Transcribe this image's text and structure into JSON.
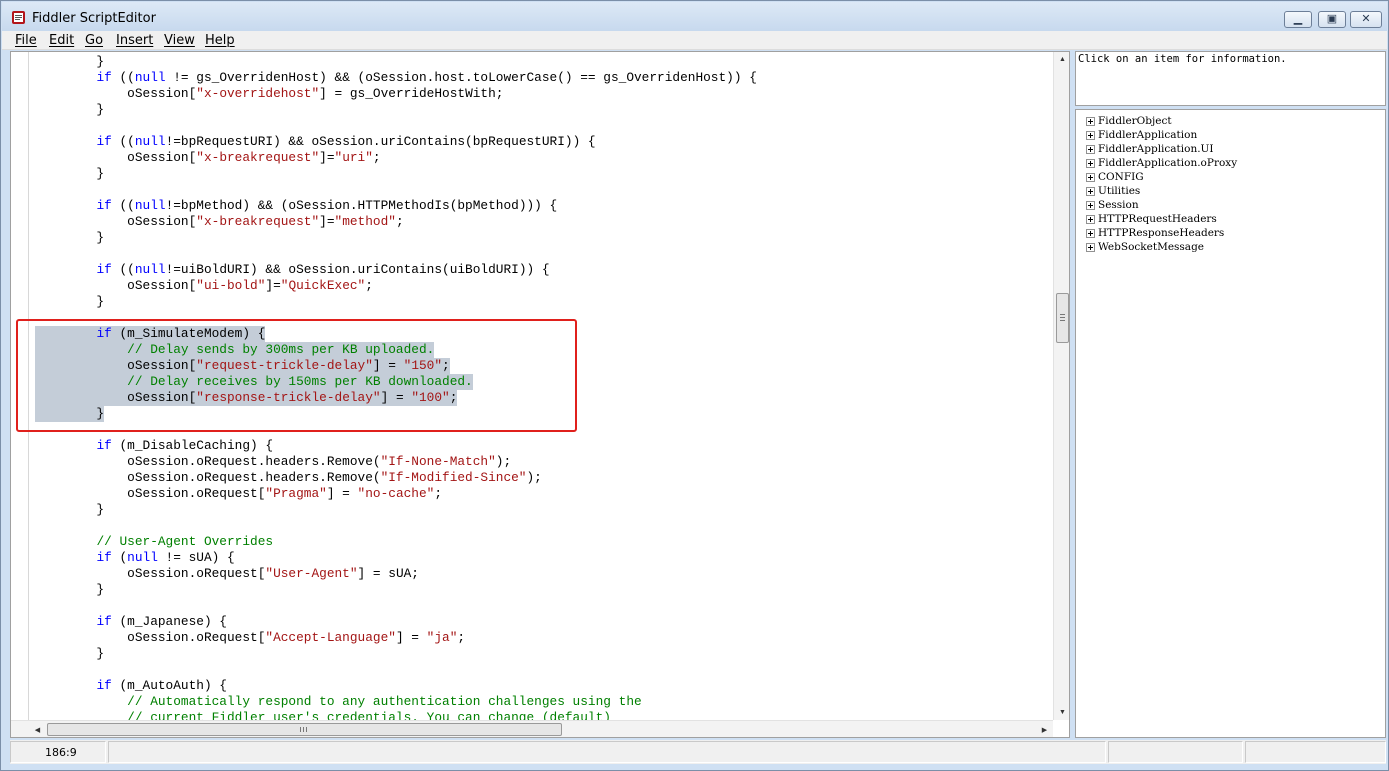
{
  "window": {
    "title": "Fiddler ScriptEditor",
    "buttons": {
      "minimize": "▁",
      "maximize": "▣",
      "close": "✕"
    }
  },
  "menu": [
    "File",
    "Edit",
    "Go",
    "Insert",
    "View",
    "Help"
  ],
  "editor": {
    "lines": [
      [
        {
          "t": "        }"
        }
      ],
      [
        {
          "t": "        "
        },
        {
          "t": "if",
          "c": "kw"
        },
        {
          "t": " (("
        },
        {
          "t": "null",
          "c": "kw"
        },
        {
          "t": " != gs_OverridenHost) && (oSession.host.toLowerCase() == gs_OverridenHost)) {"
        }
      ],
      [
        {
          "t": "            oSession["
        },
        {
          "t": "\"x-overridehost\"",
          "c": "str"
        },
        {
          "t": "] = gs_OverrideHostWith;"
        }
      ],
      [
        {
          "t": "        }"
        }
      ],
      [
        {
          "t": ""
        }
      ],
      [
        {
          "t": "        "
        },
        {
          "t": "if",
          "c": "kw"
        },
        {
          "t": " (("
        },
        {
          "t": "null",
          "c": "kw"
        },
        {
          "t": "!=bpRequestURI) && oSession.uriContains(bpRequestURI)) {"
        }
      ],
      [
        {
          "t": "            oSession["
        },
        {
          "t": "\"x-breakrequest\"",
          "c": "str"
        },
        {
          "t": "]="
        },
        {
          "t": "\"uri\"",
          "c": "str"
        },
        {
          "t": ";"
        }
      ],
      [
        {
          "t": "        }"
        }
      ],
      [
        {
          "t": ""
        }
      ],
      [
        {
          "t": "        "
        },
        {
          "t": "if",
          "c": "kw"
        },
        {
          "t": " (("
        },
        {
          "t": "null",
          "c": "kw"
        },
        {
          "t": "!=bpMethod) && (oSession.HTTPMethodIs(bpMethod))) {"
        }
      ],
      [
        {
          "t": "            oSession["
        },
        {
          "t": "\"x-breakrequest\"",
          "c": "str"
        },
        {
          "t": "]="
        },
        {
          "t": "\"method\"",
          "c": "str"
        },
        {
          "t": ";"
        }
      ],
      [
        {
          "t": "        }"
        }
      ],
      [
        {
          "t": ""
        }
      ],
      [
        {
          "t": "        "
        },
        {
          "t": "if",
          "c": "kw"
        },
        {
          "t": " (("
        },
        {
          "t": "null",
          "c": "kw"
        },
        {
          "t": "!=uiBoldURI) && oSession.uriContains(uiBoldURI)) {"
        }
      ],
      [
        {
          "t": "            oSession["
        },
        {
          "t": "\"ui-bold\"",
          "c": "str"
        },
        {
          "t": "]="
        },
        {
          "t": "\"QuickExec\"",
          "c": "str"
        },
        {
          "t": ";"
        }
      ],
      [
        {
          "t": "        }"
        }
      ],
      [
        {
          "t": ""
        }
      ],
      [
        {
          "t": "        "
        },
        {
          "t": "if",
          "c": "kw"
        },
        {
          "t": " (m_SimulateModem) {"
        }
      ],
      [
        {
          "t": "            "
        },
        {
          "t": "// Delay sends by 300ms per KB uploaded.",
          "c": "cmt"
        }
      ],
      [
        {
          "t": "            oSession["
        },
        {
          "t": "\"request-trickle-delay\"",
          "c": "str"
        },
        {
          "t": "] = "
        },
        {
          "t": "\"150\"",
          "c": "str"
        },
        {
          "t": ";"
        }
      ],
      [
        {
          "t": "            "
        },
        {
          "t": "// Delay receives by 150ms per KB downloaded.",
          "c": "cmt"
        }
      ],
      [
        {
          "t": "            oSession["
        },
        {
          "t": "\"response-trickle-delay\"",
          "c": "str"
        },
        {
          "t": "] = "
        },
        {
          "t": "\"100\"",
          "c": "str"
        },
        {
          "t": ";"
        }
      ],
      [
        {
          "t": "        }"
        }
      ],
      [
        {
          "t": ""
        }
      ],
      [
        {
          "t": "        "
        },
        {
          "t": "if",
          "c": "kw"
        },
        {
          "t": " (m_DisableCaching) {"
        }
      ],
      [
        {
          "t": "            oSession.oRequest.headers.Remove("
        },
        {
          "t": "\"If-None-Match\"",
          "c": "str"
        },
        {
          "t": ");"
        }
      ],
      [
        {
          "t": "            oSession.oRequest.headers.Remove("
        },
        {
          "t": "\"If-Modified-Since\"",
          "c": "str"
        },
        {
          "t": ");"
        }
      ],
      [
        {
          "t": "            oSession.oRequest["
        },
        {
          "t": "\"Pragma\"",
          "c": "str"
        },
        {
          "t": "] = "
        },
        {
          "t": "\"no-cache\"",
          "c": "str"
        },
        {
          "t": ";"
        }
      ],
      [
        {
          "t": "        }"
        }
      ],
      [
        {
          "t": ""
        }
      ],
      [
        {
          "t": "        "
        },
        {
          "t": "// User-Agent Overrides",
          "c": "cmt"
        }
      ],
      [
        {
          "t": "        "
        },
        {
          "t": "if",
          "c": "kw"
        },
        {
          "t": " ("
        },
        {
          "t": "null",
          "c": "kw"
        },
        {
          "t": " != sUA) {"
        }
      ],
      [
        {
          "t": "            oSession.oRequest["
        },
        {
          "t": "\"User-Agent\"",
          "c": "str"
        },
        {
          "t": "] = sUA;"
        }
      ],
      [
        {
          "t": "        }"
        }
      ],
      [
        {
          "t": ""
        }
      ],
      [
        {
          "t": "        "
        },
        {
          "t": "if",
          "c": "kw"
        },
        {
          "t": " (m_Japanese) {"
        }
      ],
      [
        {
          "t": "            oSession.oRequest["
        },
        {
          "t": "\"Accept-Language\"",
          "c": "str"
        },
        {
          "t": "] = "
        },
        {
          "t": "\"ja\"",
          "c": "str"
        },
        {
          "t": ";"
        }
      ],
      [
        {
          "t": "        }"
        }
      ],
      [
        {
          "t": ""
        }
      ],
      [
        {
          "t": "        "
        },
        {
          "t": "if",
          "c": "kw"
        },
        {
          "t": " (m_AutoAuth) {"
        }
      ],
      [
        {
          "t": "            "
        },
        {
          "t": "// Automatically respond to any authentication challenges using the",
          "c": "cmt"
        }
      ],
      [
        {
          "t": "            "
        },
        {
          "t": "// current Fiddler user's credentials. You can change (default)",
          "c": "cmt"
        }
      ]
    ],
    "selected_lines": [
      17,
      18,
      19,
      20,
      21,
      22
    ]
  },
  "info_panel": {
    "text": "Click on an item for information."
  },
  "tree": [
    "FiddlerObject",
    "FiddlerApplication",
    "FiddlerApplication.UI",
    "FiddlerApplication.oProxy",
    "CONFIG",
    "Utilities",
    "Session",
    "HTTPRequestHeaders",
    "HTTPResponseHeaders",
    "WebSocketMessage"
  ],
  "status": {
    "position": "186:9"
  },
  "colors": {
    "highlight_box": "#e0201c",
    "selection": "#c4cdd8",
    "keyword": "#0000ff",
    "string": "#a31515",
    "comment": "#008000"
  }
}
